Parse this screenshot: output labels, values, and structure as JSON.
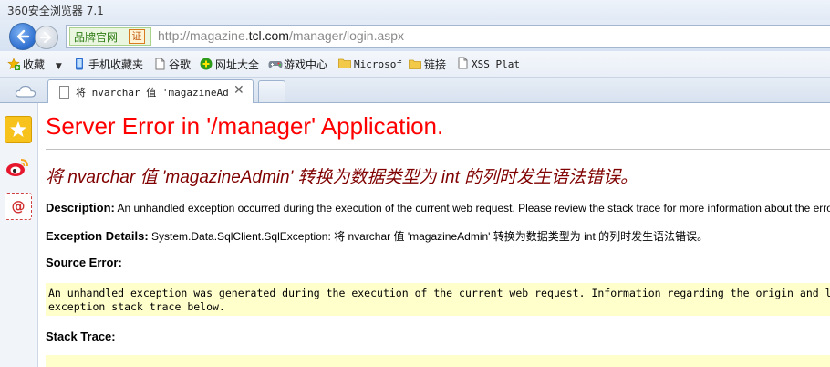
{
  "window": {
    "title": "360安全浏览器 7.1"
  },
  "nav": {
    "brand_label": "品牌官网",
    "cert_badge": "证",
    "url_prefix": "http://magazine.",
    "url_host": "tcl.com",
    "url_path": "/manager/login.aspx"
  },
  "favorites": [
    {
      "label": "收藏",
      "icon": "star-plus-icon"
    },
    {
      "label": "手机收藏夹",
      "icon": "phone-icon"
    },
    {
      "label": "谷歌",
      "icon": "page-icon"
    },
    {
      "label": "网址大全",
      "icon": "green-plus-icon"
    },
    {
      "label": "游戏中心",
      "icon": "gamepad-icon"
    },
    {
      "label": "Microsof",
      "icon": "folder-icon"
    },
    {
      "label": "链接",
      "icon": "folder-icon"
    },
    {
      "label": "XSS Plat",
      "icon": "page-icon"
    }
  ],
  "tabs": [
    {
      "title": "将 nvarchar 值 'magazineAdmi",
      "close": "✕"
    }
  ],
  "sidebar": [
    "favorites-star-icon",
    "weibo-icon",
    "email-icon"
  ],
  "page": {
    "heading": "Server Error in '/manager' Application.",
    "error_message": "将 nvarchar 值 'magazineAdmin' 转换为数据类型为 int 的列时发生语法错误。",
    "description_label": "Description:",
    "description_text": " An unhandled exception occurred during the execution of the current web request. Please review the stack trace for more information about the error and where it originated in the code.",
    "exception_label": "Exception Details:",
    "exception_text": " System.Data.SqlClient.SqlException: 将 nvarchar 值 'magazineAdmin' 转换为数据类型为 int 的列时发生语法错误。",
    "source_error_label": "Source Error:",
    "source_error_line1": "An unhandled exception was generated during the execution of the current web request. Information regarding the origin and location of the exception can be identified using the",
    "source_error_line2": "exception stack trace below.",
    "stack_trace_label": "Stack Trace:"
  },
  "colors": {
    "heading": "#ff0000",
    "error_message": "#800000",
    "code_background": "#ffffcc"
  }
}
